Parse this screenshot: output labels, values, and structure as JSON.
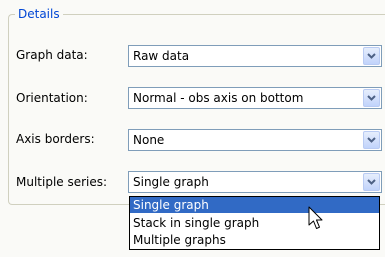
{
  "details": {
    "legend": "Details",
    "rows": [
      {
        "label": "Graph data:",
        "value": "Raw data"
      },
      {
        "label": "Orientation:",
        "value": "Normal - obs axis on bottom"
      },
      {
        "label": "Axis borders:",
        "value": "None"
      },
      {
        "label": "Multiple series:",
        "value": "Single graph"
      }
    ]
  },
  "dropdown": {
    "options": [
      "Single graph",
      "Stack in single graph",
      "Multiple graphs"
    ],
    "highlighted": "Single graph"
  },
  "icons": {
    "combo_arrow": "chevron-down-icon",
    "cursor": "mouse-pointer-icon"
  },
  "colors": {
    "legend_text": "#0046d5",
    "combo_border": "#7f9db9",
    "selection_bg": "#316ac5",
    "selection_text": "#ffffff",
    "arrow": "#4d6185"
  }
}
